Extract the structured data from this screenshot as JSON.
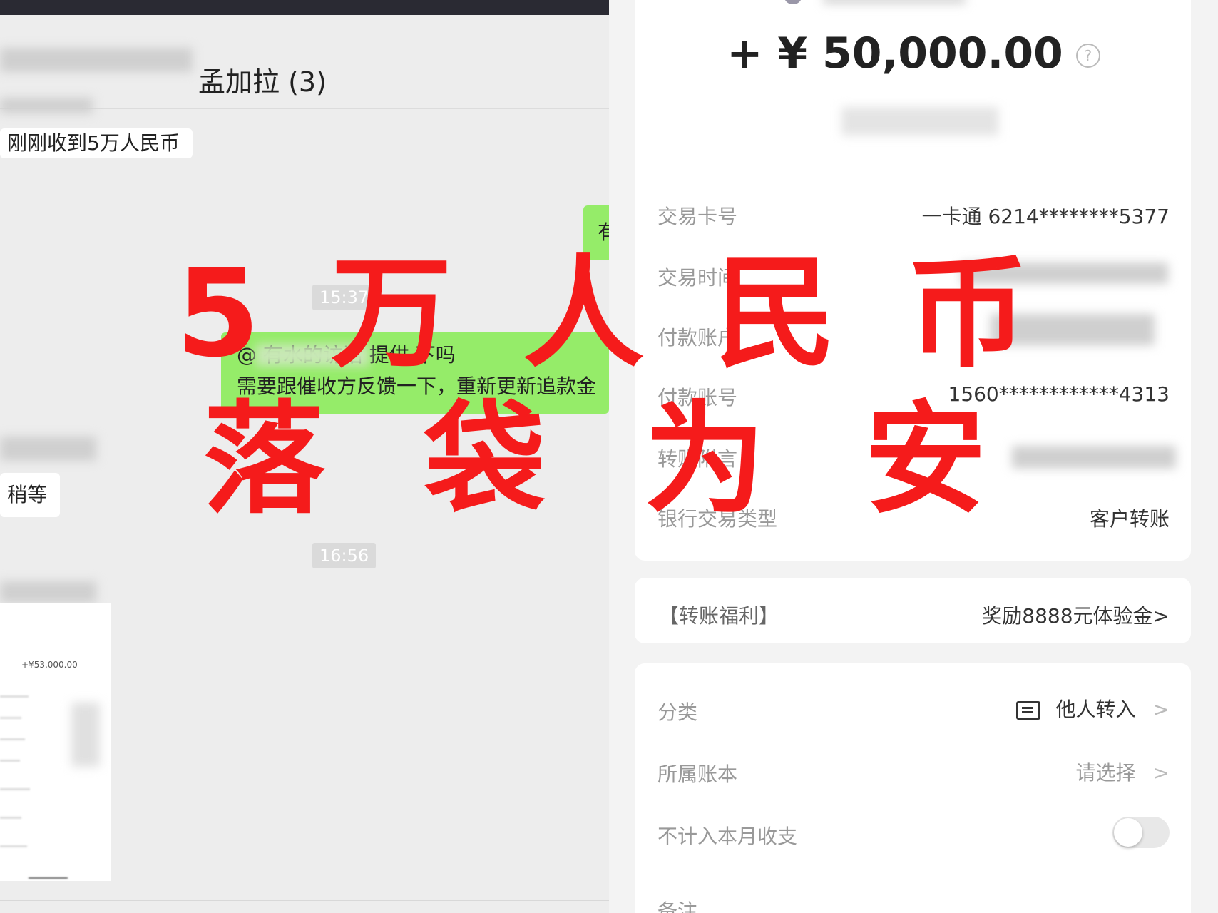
{
  "chat": {
    "title": "孟加拉 (3)",
    "messages": [
      {
        "side": "left",
        "text": "刚刚收到5万人民币"
      },
      {
        "side": "right",
        "text": "有"
      },
      {
        "side": "right",
        "text": "@        有水的访话 提供 下吗",
        "text2": "需要跟催收方反馈一下，重新更新追款金"
      },
      {
        "side": "left",
        "text": "稍等"
      }
    ],
    "timestamps": [
      "15:37",
      "16:56"
    ],
    "image_preview_amount": "+¥53,000.00"
  },
  "detail": {
    "amount": "+ ¥ 50,000.00",
    "help_icon": "question-circle-icon",
    "rows": [
      {
        "label": "交易卡号",
        "value": "一卡通 6214********5377"
      },
      {
        "label": "交易时间",
        "value": ""
      },
      {
        "label": "付款账号",
        "value": "1560************4313"
      },
      {
        "label": "转账附言",
        "value": ""
      },
      {
        "label": "银行交易类型",
        "value": "客户转账"
      }
    ],
    "payer_label": "付款账户",
    "promo": {
      "label": "【转账福利】",
      "value": "奖励8888元体验金>"
    },
    "category": {
      "label": "分类",
      "value": "他人转入"
    },
    "ledger": {
      "label": "所属账本",
      "value": "请选择"
    },
    "exclude": {
      "label": "不计入本月收支",
      "on": false
    },
    "note": {
      "label": "备注"
    }
  },
  "overlay": {
    "line1": "5 万 人 民 币",
    "line2": "落 袋 为 安",
    "color": "#f51b1b"
  }
}
